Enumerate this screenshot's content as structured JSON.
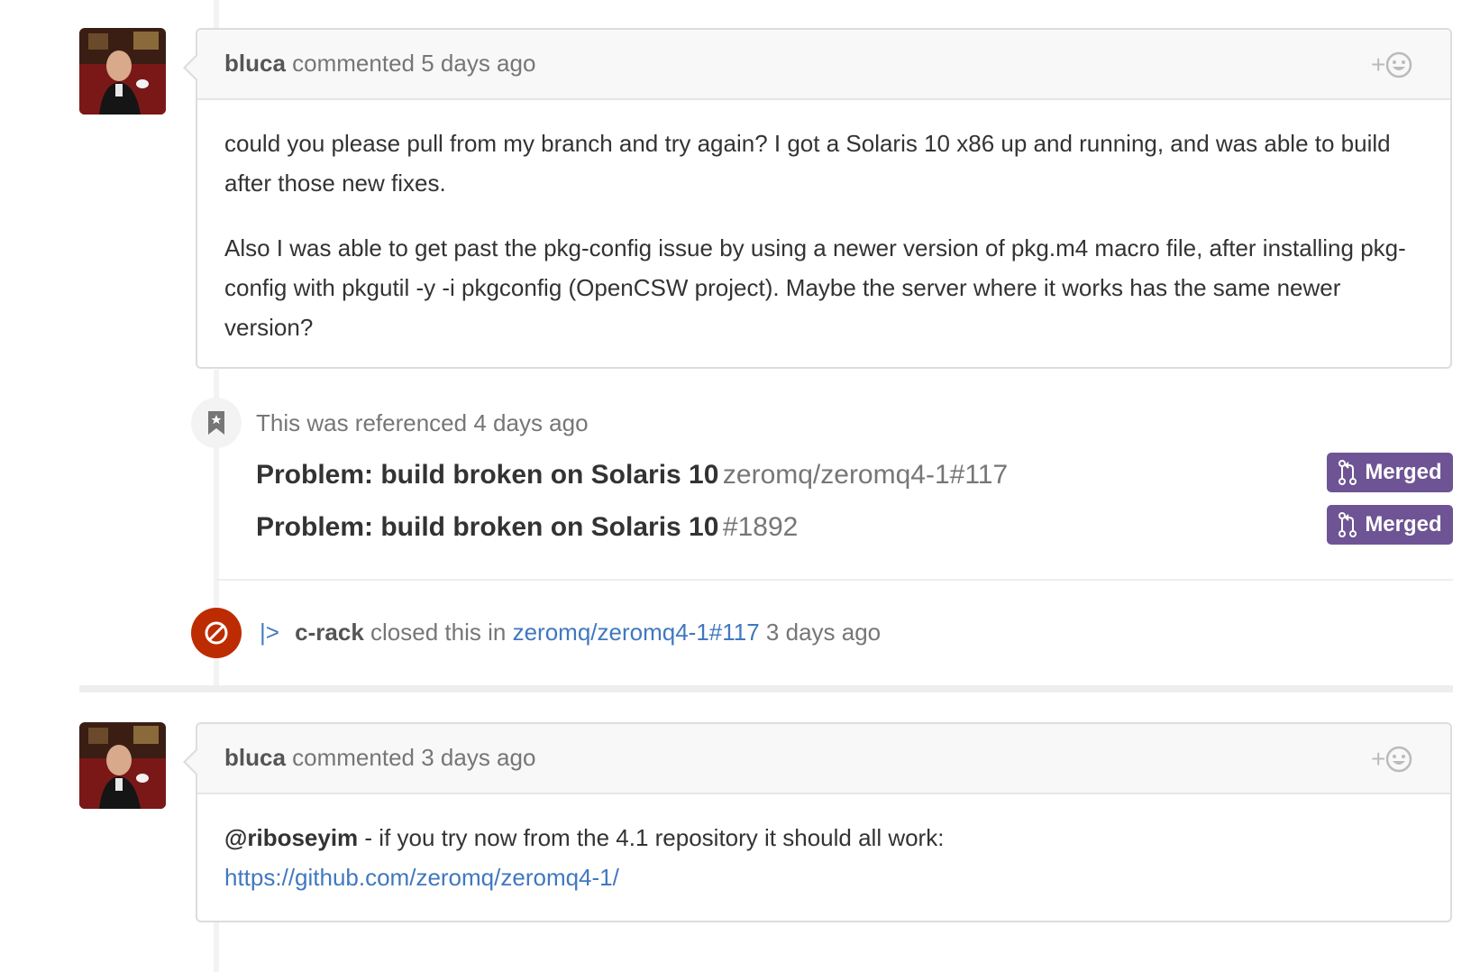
{
  "comments": [
    {
      "author": "bluca",
      "action": "commented",
      "time": "5 days ago",
      "paragraphs": [
        "could you please pull from my branch and try again? I got a Solaris 10 x86 up and running, and was able to build after those new fixes.",
        "Also I was able to get past the pkg-config issue by using a newer version of pkg.m4 macro file, after installing pkg-config with pkgutil -y -i pkgconfig (OpenCSW project). Maybe the server where it works has the same newer version?"
      ],
      "reaction_label": "+"
    },
    {
      "author": "bluca",
      "action": "commented",
      "time": "3 days ago",
      "mention": "@riboseyim",
      "text": " - if you try now from the 4.1 repository it should all work:",
      "link": "https://github.com/zeromq/zeromq4-1/",
      "reaction_label": "+"
    }
  ],
  "reference_event": {
    "text": "This was referenced",
    "time": "4 days ago",
    "icon": "bookmark-icon",
    "items": [
      {
        "title": "Problem: build broken on Solaris 10",
        "ref": "zeromq/zeromq4-1#117",
        "status": "Merged"
      },
      {
        "title": "Problem: build broken on Solaris 10",
        "ref": "#1892",
        "status": "Merged"
      }
    ]
  },
  "close_event": {
    "prefix": "|>",
    "actor": "c-rack",
    "action": "closed this in",
    "ref": "zeromq/zeromq4-1#117",
    "time": "3 days ago",
    "icon": "circle-slash-icon"
  },
  "colors": {
    "merged": "#6e5494",
    "closed": "#bd2c00",
    "link": "#4078c0"
  }
}
